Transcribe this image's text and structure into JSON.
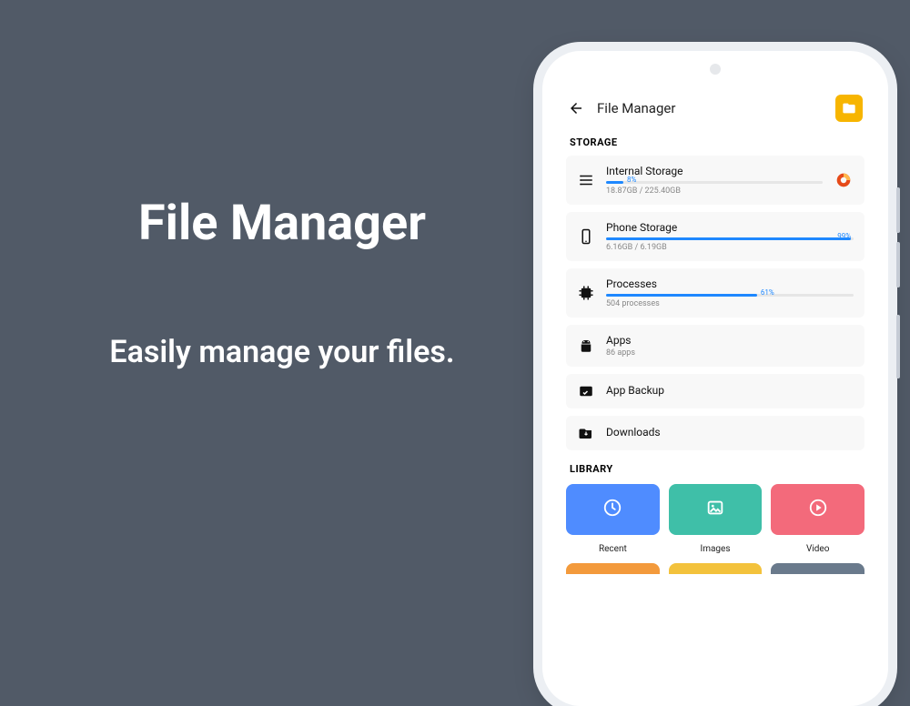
{
  "promo": {
    "title": "File Manager",
    "subtitle": "Easily manage your files."
  },
  "app": {
    "title": "File Manager",
    "sections": {
      "storage_label": "STORAGE",
      "library_label": "LIBRARY"
    },
    "storage": [
      {
        "id": "internal",
        "title": "Internal Storage",
        "percent": 8,
        "percent_label": "8%",
        "sub": "18.87GB / 225.40GB",
        "has_bar": true,
        "has_pie": true
      },
      {
        "id": "phone",
        "title": "Phone Storage",
        "percent": 99,
        "percent_label": "99%",
        "sub": "6.16GB / 6.19GB",
        "has_bar": true,
        "has_pie": false
      },
      {
        "id": "processes",
        "title": "Processes",
        "percent": 61,
        "percent_label": "61%",
        "sub": "504 processes",
        "has_bar": true,
        "has_pie": false
      },
      {
        "id": "apps",
        "title": "Apps",
        "sub": "86 apps",
        "has_bar": false,
        "has_pie": false
      },
      {
        "id": "appbackup",
        "title": "App Backup",
        "sub": "",
        "has_bar": false,
        "has_pie": false
      },
      {
        "id": "downloads",
        "title": "Downloads",
        "sub": "",
        "has_bar": false,
        "has_pie": false
      }
    ],
    "library": [
      {
        "id": "recent",
        "label": "Recent",
        "color": "#4f8cff",
        "icon": "clock"
      },
      {
        "id": "images",
        "label": "Images",
        "color": "#3fbfa8",
        "icon": "image"
      },
      {
        "id": "video",
        "label": "Video",
        "color": "#f36a7b",
        "icon": "play"
      }
    ],
    "library_row2_colors": [
      "#f39a3c",
      "#f3c23c",
      "#6a7a8c"
    ]
  },
  "colors": {
    "accent_folder": "#f7b500",
    "bar": "#1e88ff",
    "pie_a": "#e64a19",
    "pie_b": "#ffb74d"
  }
}
